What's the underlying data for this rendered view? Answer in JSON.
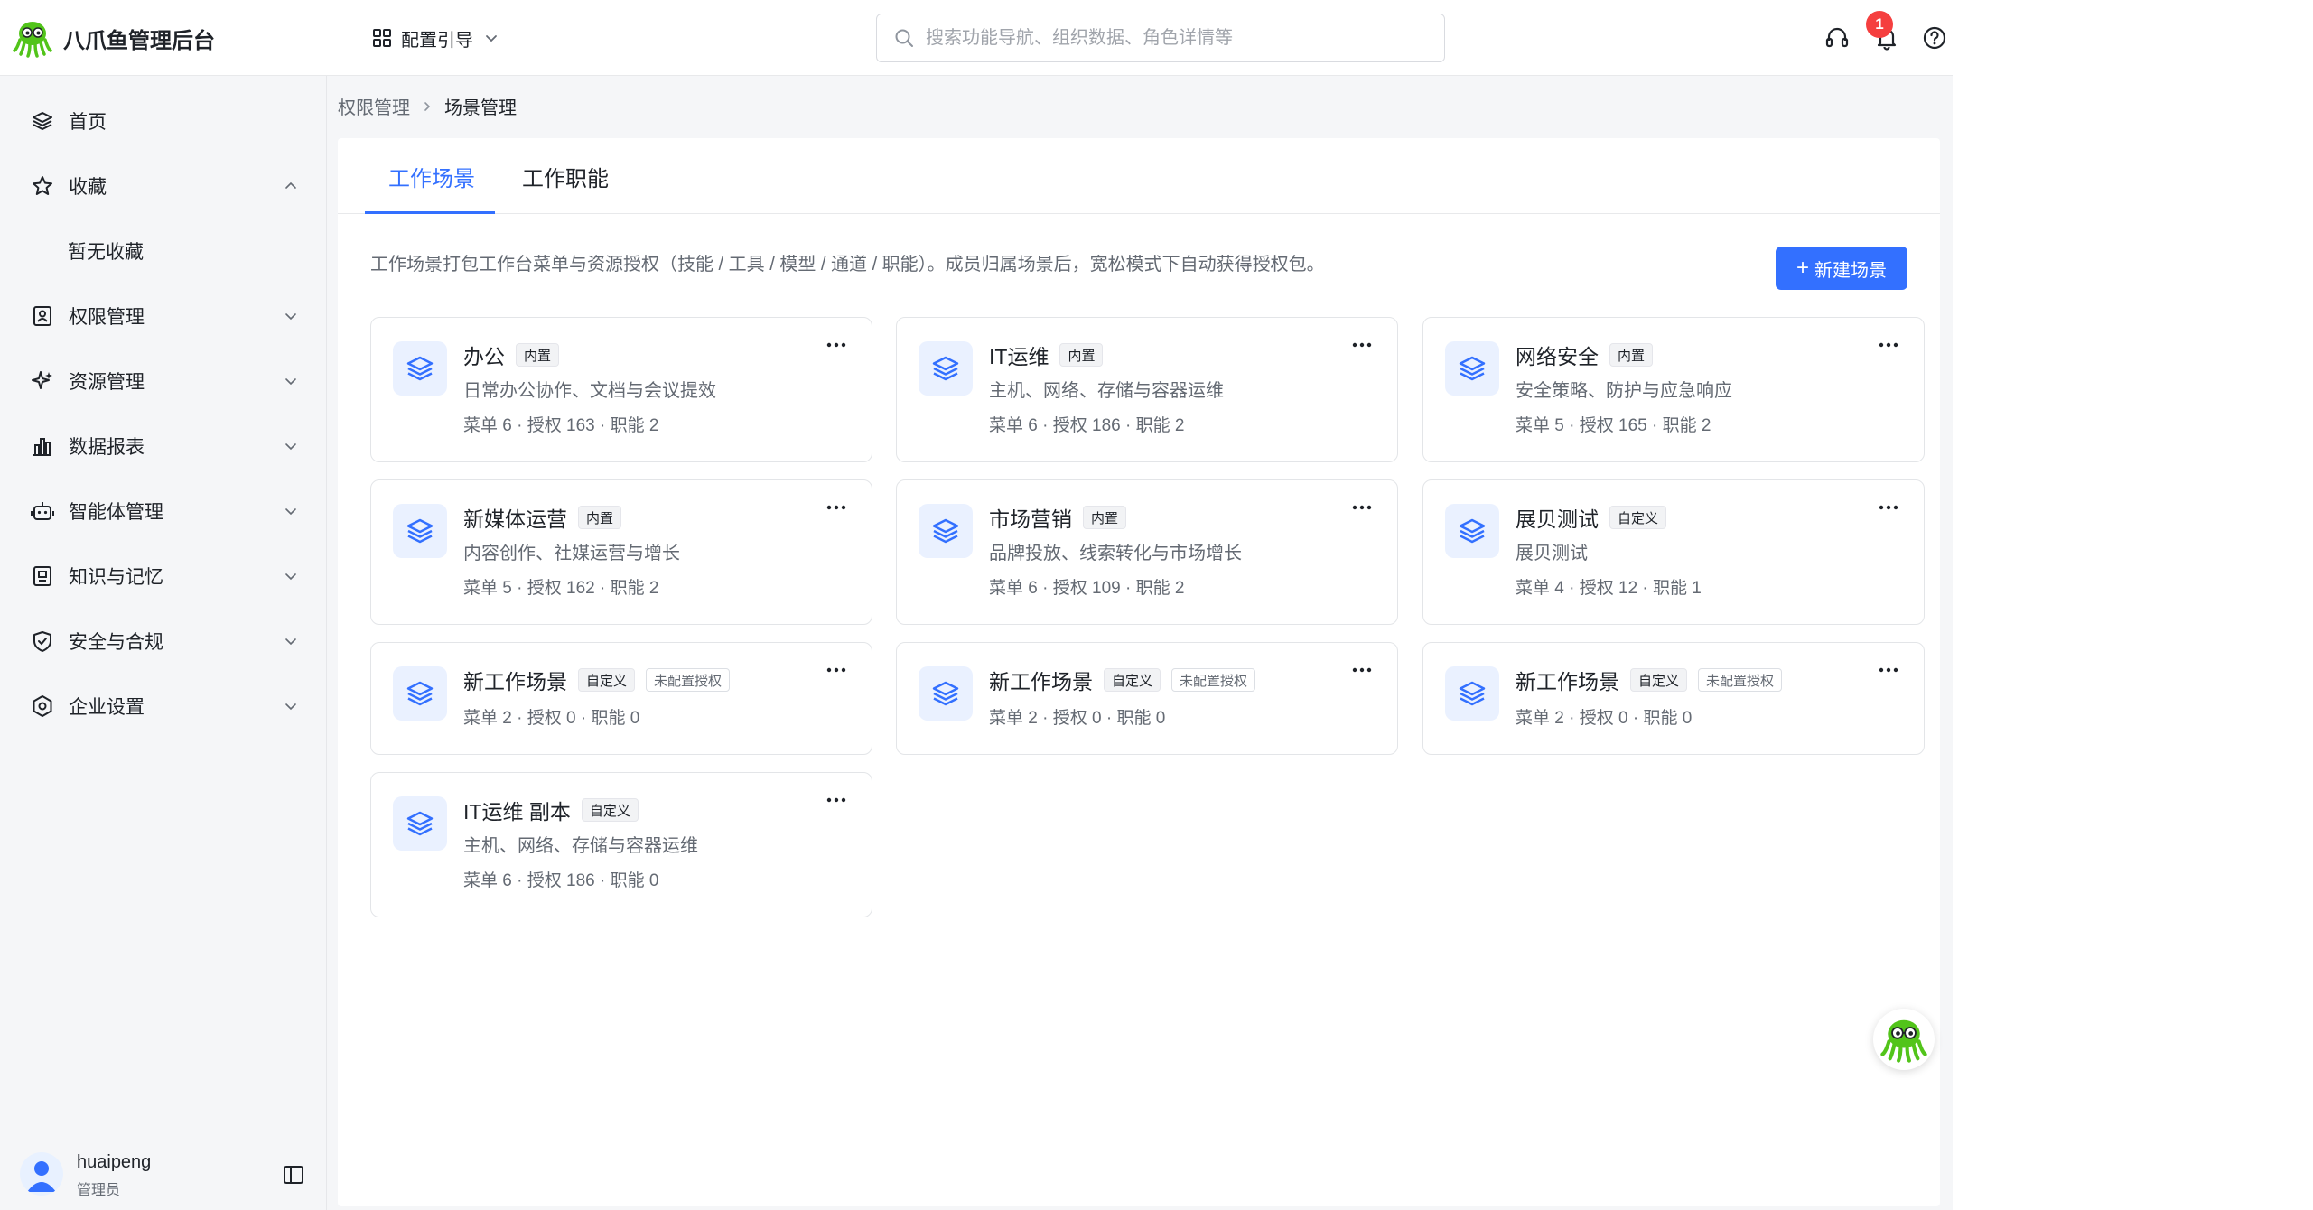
{
  "app": {
    "title": "八爪鱼管理后台",
    "guide_label": "配置引导"
  },
  "header": {
    "search_placeholder": "搜索功能导航、组织数据、角色详情等",
    "notification_count": "1"
  },
  "sidebar": {
    "items": [
      {
        "label": "首页",
        "icon": "layers-icon"
      },
      {
        "label": "收藏",
        "icon": "star-icon",
        "expanded": true
      },
      {
        "label": "权限管理",
        "icon": "id-card-icon"
      },
      {
        "label": "资源管理",
        "icon": "sparkle-icon"
      },
      {
        "label": "数据报表",
        "icon": "bar-chart-icon"
      },
      {
        "label": "智能体管理",
        "icon": "robot-icon"
      },
      {
        "label": "知识与记忆",
        "icon": "book-icon"
      },
      {
        "label": "安全与合规",
        "icon": "shield-check-icon"
      },
      {
        "label": "企业设置",
        "icon": "hexagon-gear-icon"
      }
    ],
    "favorites_empty": "暂无收藏",
    "user": {
      "name": "huaipeng",
      "role": "管理员"
    }
  },
  "breadcrumb": {
    "parent": "权限管理",
    "current": "场景管理"
  },
  "tabs": [
    {
      "label": "工作场景",
      "active": true
    },
    {
      "label": "工作职能",
      "active": false
    }
  ],
  "description": "工作场景打包工作台菜单与资源授权（技能 / 工具 / 模型 / 通道 / 职能）。成员归属场景后，宽松模式下自动获得授权包。",
  "new_button_label": "新建场景",
  "cards": [
    {
      "title": "办公",
      "tags": [
        "内置"
      ],
      "desc": "日常办公协作、文档与会议提效",
      "stats": "菜单 6 · 授权 163 · 职能 2"
    },
    {
      "title": "IT运维",
      "tags": [
        "内置"
      ],
      "desc": "主机、网络、存储与容器运维",
      "stats": "菜单 6 · 授权 186 · 职能 2"
    },
    {
      "title": "网络安全",
      "tags": [
        "内置"
      ],
      "desc": "安全策略、防护与应急响应",
      "stats": "菜单 5 · 授权 165 · 职能 2"
    },
    {
      "title": "新媒体运营",
      "tags": [
        "内置"
      ],
      "desc": "内容创作、社媒运营与增长",
      "stats": "菜单 5 · 授权 162 · 职能 2"
    },
    {
      "title": "市场营销",
      "tags": [
        "内置"
      ],
      "desc": "品牌投放、线索转化与市场增长",
      "stats": "菜单 6 · 授权 109 · 职能 2"
    },
    {
      "title": "展贝测试",
      "tags": [
        "自定义"
      ],
      "desc": "展贝测试",
      "stats": "菜单 4 · 授权 12 · 职能 1"
    },
    {
      "title": "新工作场景",
      "tags": [
        "自定义",
        "未配置授权"
      ],
      "desc": "",
      "stats": "菜单 2 · 授权 0 · 职能 0"
    },
    {
      "title": "新工作场景",
      "tags": [
        "自定义",
        "未配置授权"
      ],
      "desc": "",
      "stats": "菜单 2 · 授权 0 · 职能 0"
    },
    {
      "title": "新工作场景",
      "tags": [
        "自定义",
        "未配置授权"
      ],
      "desc": "",
      "stats": "菜单 2 · 授权 0 · 职能 0"
    },
    {
      "title": "IT运维 副本",
      "tags": [
        "自定义"
      ],
      "desc": "主机、网络、存储与容器运维",
      "stats": "菜单 6 · 授权 186 · 职能 0"
    }
  ],
  "colors": {
    "accent": "#3370ff",
    "badge": "#f53f3f",
    "icon_bg": "#eaf1ff"
  }
}
